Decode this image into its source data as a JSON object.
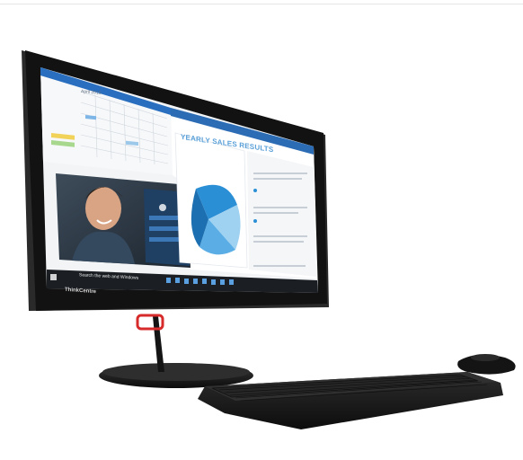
{
  "product": {
    "brand_label": "ThinkCentre",
    "taskbar_search_placeholder": "Search the web and Windows"
  },
  "screen": {
    "slide_title": "YEARLY SALES RESULTS",
    "calendar_title": "April 2015"
  },
  "colors": {
    "bezel": "#121212",
    "accent_blue": "#2b8fd6",
    "light_blue": "#9fd2f1",
    "stand_red": "#d72b2b",
    "keyboard": "#1a1a1a"
  }
}
